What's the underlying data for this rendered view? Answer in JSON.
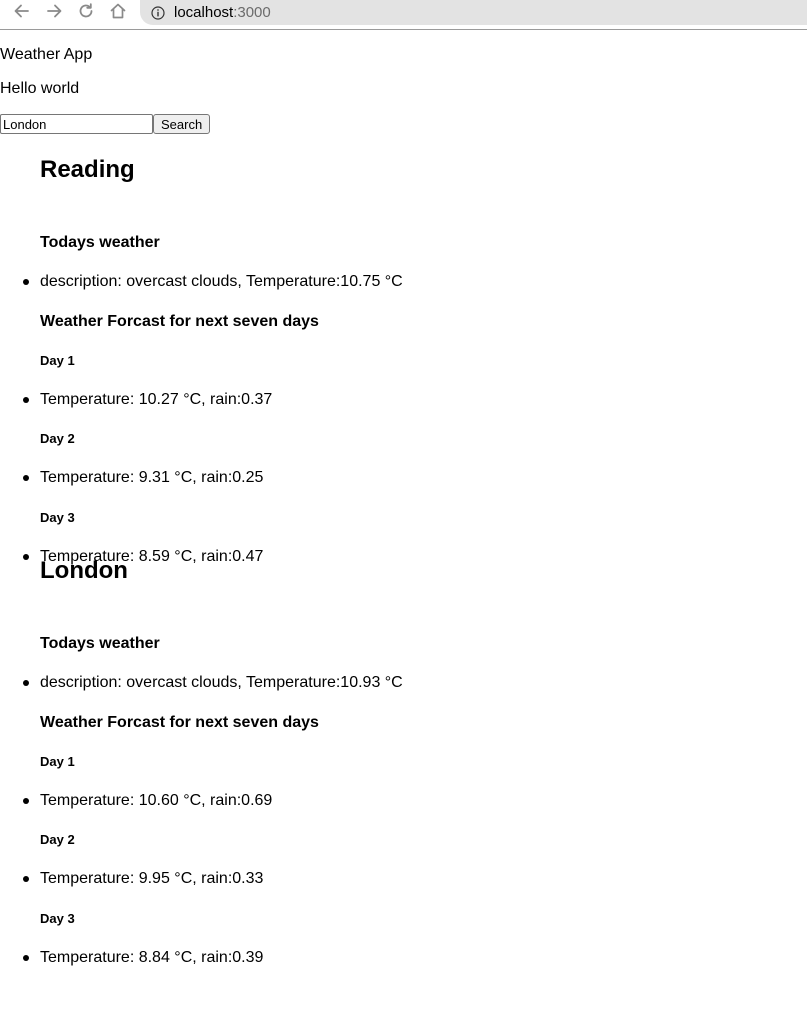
{
  "browser": {
    "url_host": "localhost",
    "url_port": ":3000",
    "icons": {
      "back": "arrow-left-icon",
      "forward": "arrow-right-icon",
      "reload": "reload-icon",
      "home": "home-icon",
      "info": "info-icon"
    }
  },
  "app": {
    "title": "Weather App",
    "greeting": "Hello world",
    "search": {
      "value": "London",
      "button_label": "Search"
    }
  },
  "cities": [
    {
      "name": "Reading",
      "today_heading": "Todays weather",
      "today": "description: overcast clouds, Temperature:10.75 °C",
      "forecast_heading": "Weather Forcast for next seven days",
      "days": [
        {
          "label": "Day 1",
          "text": "Temperature: 10.27 °C, rain:0.37"
        },
        {
          "label": "Day 2",
          "text": "Temperature: 9.31 °C, rain:0.25"
        },
        {
          "label": "Day 3",
          "text": "Temperature: 8.59 °C, rain:0.47"
        }
      ]
    },
    {
      "name": "London",
      "today_heading": "Todays weather",
      "today": "description: overcast clouds, Temperature:10.93 °C",
      "forecast_heading": "Weather Forcast for next seven days",
      "days": [
        {
          "label": "Day 1",
          "text": "Temperature: 10.60 °C, rain:0.69"
        },
        {
          "label": "Day 2",
          "text": "Temperature: 9.95 °C, rain:0.33"
        },
        {
          "label": "Day 3",
          "text": "Temperature: 8.84 °C, rain:0.39"
        }
      ]
    }
  ]
}
